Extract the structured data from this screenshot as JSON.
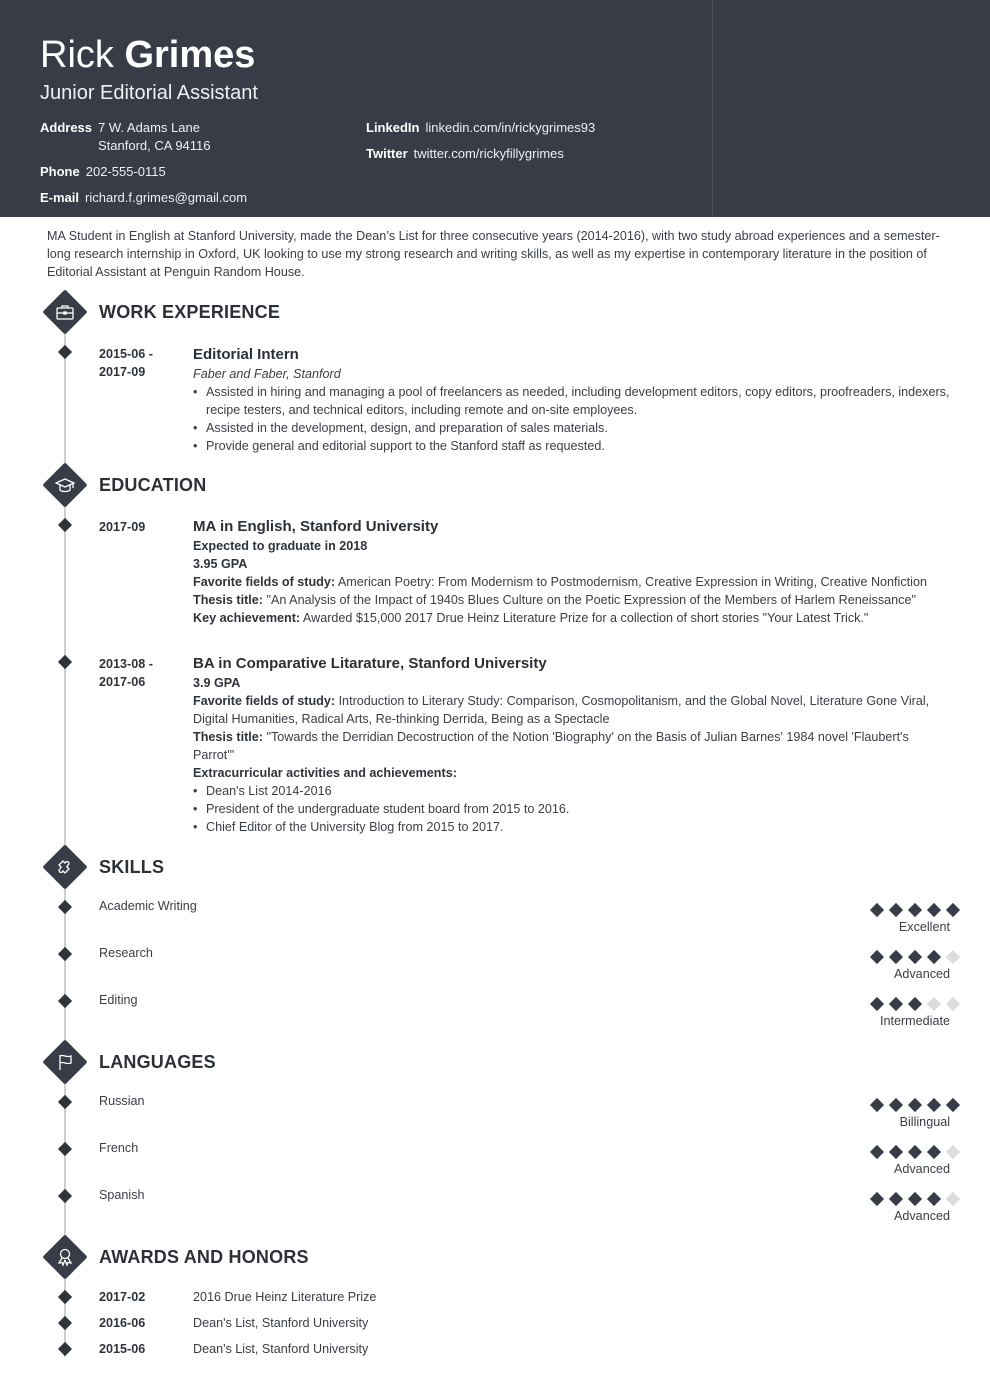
{
  "header": {
    "first_name": "Rick",
    "last_name": "Grimes",
    "job_title": "Junior Editorial Assistant",
    "background_color": "#373c46",
    "contacts": {
      "address_label": "Address",
      "address_line1": "7 W. Adams Lane",
      "address_line2": "Stanford, CA 94116",
      "phone_label": "Phone",
      "phone": "202-555-0115",
      "email_label": "E-mail",
      "email": "richard.f.grimes@gmail.com",
      "linkedin_label": "LinkedIn",
      "linkedin": "linkedin.com/in/rickygrimes93",
      "twitter_label": "Twitter",
      "twitter": "twitter.com/rickyfillygrimes"
    }
  },
  "summary": "MA Student in English at Stanford University, made the Dean’s List for three consecutive years (2014-2016), with two study abroad experiences and a semester-long research internship in Oxford, UK looking to use my strong research and writing skills, as well as my expertise in contemporary literature in the position of Editorial Assistant at Penguin Random House.",
  "sections": {
    "work": {
      "title": "WORK EXPERIENCE",
      "icon": "briefcase-icon",
      "items": [
        {
          "date_start": "2015-06 -",
          "date_end": "2017-09",
          "role": "Editorial Intern",
          "company": "Faber and Faber, Stanford",
          "bullets": [
            "Assisted in hiring and managing a pool of freelancers as needed, including development editors, copy editors, proofreaders, indexers, recipe testers, and technical editors, including remote and on-site employees.",
            "Assisted in the development, design, and preparation of sales materials.",
            "Provide general and editorial support to the Stanford staff as requested."
          ]
        }
      ]
    },
    "education": {
      "title": "EDUCATION",
      "icon": "graduation-cap-icon",
      "items": [
        {
          "date": "2017-09",
          "degree": "MA in English, Stanford University",
          "note": "Expected to graduate in 2018",
          "gpa": "3.95 GPA",
          "fields_label": "Favorite fields of study:",
          "fields": "American Poetry: From Modernism to Postmodernism, Creative Expression in Writing, Creative Nonfiction",
          "thesis_label": "Thesis title:",
          "thesis": "\"An Analysis of the Impact of 1940s Blues Culture on the Poetic Expression of the Members of Harlem Reneissance\"",
          "achievement_label": "Key achievement:",
          "achievement": "Awarded $15,000 2017 Drue Heinz Literature Prize for a collection of short stories \"Your Latest Trick.\""
        },
        {
          "date_start": "2013-08 -",
          "date_end": "2017-06",
          "degree": "BA in Comparative Litarature, Stanford University",
          "gpa": "3.9 GPA",
          "fields_label": "Favorite fields of study:",
          "fields": "Introduction to Literary Study: Comparison, Cosmopolitanism, and the Global Novel, Literature Gone Viral, Digital Humanities, Radical Arts, Re-thinking Derrida, Being as a Spectacle",
          "thesis_label": "Thesis title:",
          "thesis": "\"Towards the Derridian Decostruction of the Notion 'Biography' on the Basis of Julian Barnes' 1984 novel 'Flaubert's Parrot'\"",
          "extra_label": "Extracurricular activities and achievements:",
          "extra": [
            "Dean's List 2014-2016",
            "President of the undergraduate student board from 2015 to 2016.",
            "Chief Editor of the University Blog from 2015 to 2017."
          ]
        }
      ]
    },
    "skills": {
      "title": "SKILLS",
      "icon": "puzzle-piece-icon",
      "items": [
        {
          "name": "Academic Writing",
          "level": "Excellent",
          "rating": 5,
          "max": 5
        },
        {
          "name": "Research",
          "level": "Advanced",
          "rating": 4,
          "max": 5
        },
        {
          "name": "Editing",
          "level": "Intermediate",
          "rating": 3,
          "max": 5
        }
      ]
    },
    "languages": {
      "title": "LANGUAGES",
      "icon": "flag-icon",
      "items": [
        {
          "name": "Russian",
          "level": "Billingual",
          "rating": 5,
          "max": 5
        },
        {
          "name": "French",
          "level": "Advanced",
          "rating": 4,
          "max": 5
        },
        {
          "name": "Spanish",
          "level": "Advanced",
          "rating": 4,
          "max": 5
        }
      ]
    },
    "awards": {
      "title": "AWARDS AND HONORS",
      "icon": "award-ribbon-icon",
      "items": [
        {
          "date": "2017-02",
          "text": "2016 Drue Heinz Literature Prize"
        },
        {
          "date": "2016-06",
          "text": "Dean's List, Stanford University"
        },
        {
          "date": "2015-06",
          "text": "Dean's List, Stanford University"
        }
      ]
    }
  }
}
